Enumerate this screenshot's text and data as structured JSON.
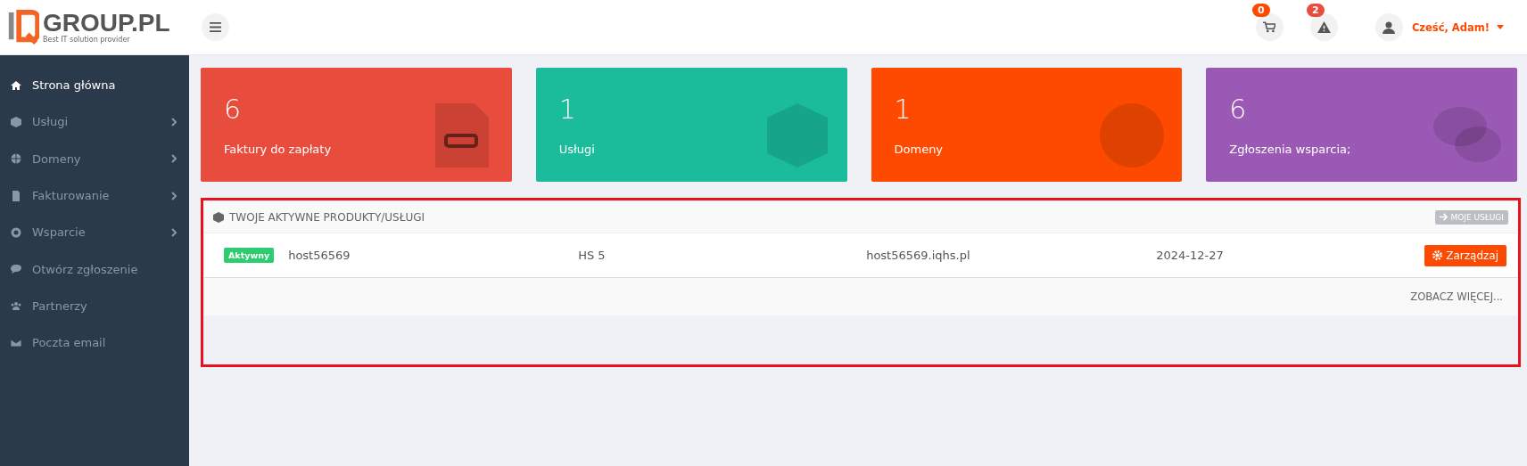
{
  "logo": {
    "name": "GROUP.PL",
    "tagline": "Best IT solution provider"
  },
  "header": {
    "cart_count": "0",
    "alerts_count": "2",
    "greeting": "Cześć, Adam!"
  },
  "sidebar": {
    "items": [
      {
        "label": "Strona główna",
        "selected": true,
        "submenu": false
      },
      {
        "label": "Usługi",
        "selected": false,
        "submenu": true
      },
      {
        "label": "Domeny",
        "selected": false,
        "submenu": true
      },
      {
        "label": "Fakturowanie",
        "selected": false,
        "submenu": true
      },
      {
        "label": "Wsparcie",
        "selected": false,
        "submenu": true
      },
      {
        "label": "Otwórz zgłoszenie",
        "selected": false,
        "submenu": false
      },
      {
        "label": "Partnerzy",
        "selected": false,
        "submenu": false
      },
      {
        "label": "Poczta email",
        "selected": false,
        "submenu": false
      }
    ]
  },
  "cards": [
    {
      "value": "6",
      "label": "Faktury do zapłaty",
      "color": "#e74c3c"
    },
    {
      "value": "1",
      "label": "Usługi",
      "color": "#1abc9c"
    },
    {
      "value": "1",
      "label": "Domeny",
      "color": "#fe4a01"
    },
    {
      "value": "6",
      "label": "Zgłoszenia wsparcia;",
      "color": "#9b59b6"
    }
  ],
  "products": {
    "title": "TWOJE AKTYWNE PRODUKTY/USŁUGI",
    "header_button": "MOJE USŁUGI",
    "rows": [
      {
        "status": "Aktywny",
        "name": "host56569",
        "plan": "HS 5",
        "domain": "host56569.iqhs.pl",
        "date": "2024-12-27",
        "action": "Zarządzaj"
      }
    ],
    "more": "ZOBACZ WIĘCEJ..."
  }
}
